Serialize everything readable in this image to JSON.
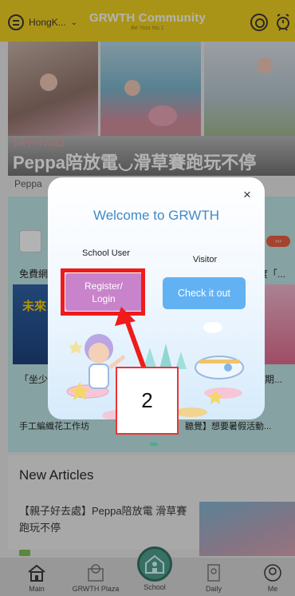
{
  "header": {
    "city": "HongK...",
    "title": "GRWTH Community",
    "subtitle": "Be Your No.1"
  },
  "banner": {
    "tag": "【親子好去處】",
    "headline": "Peppa陪放電◡滑草賽跑玩不停"
  },
  "background": {
    "strip_text": "Peppa",
    "left_text_1": "免費網",
    "right_text_1": "度「...",
    "poster_text": "未來",
    "bottom_left_1": "「坐少",
    "bottom_right_1": "暑期...",
    "bottom_left_2": "手工編織花工作坊",
    "bottom_right_2": "聽覺】想要暑假活動..."
  },
  "modal": {
    "close": "×",
    "title": "Welcome to GRWTH",
    "school_user_label": "School User",
    "visitor_label": "Visitor",
    "register_button": "Register/\nLogin",
    "visitor_button": "Check it out"
  },
  "annotation": {
    "step_number": "2",
    "highlight_color": "#ef1b1b"
  },
  "articles": {
    "title": "New Articles",
    "item_text": "【親子好去處】Peppa陪放電 滑草賽跑玩不停"
  },
  "nav": {
    "items": [
      {
        "label": "Main",
        "icon": "home-icon"
      },
      {
        "label": "GRWTH Plaza",
        "icon": "plaza-icon"
      },
      {
        "label": "School",
        "icon": "school-icon"
      },
      {
        "label": "Daily",
        "icon": "daily-icon"
      },
      {
        "label": "Me",
        "icon": "profile-icon"
      }
    ]
  },
  "colors": {
    "header_bg": "#f2d21b",
    "modal_title": "#3f8ac7",
    "register_bg": "#c883ca",
    "visitor_bg": "#62b1f3"
  }
}
